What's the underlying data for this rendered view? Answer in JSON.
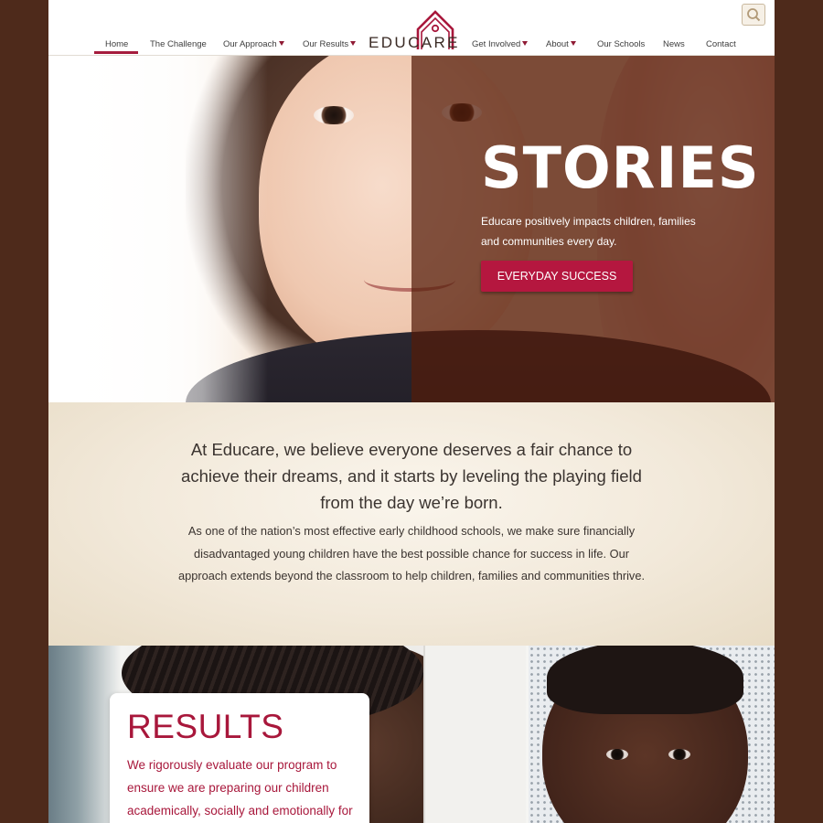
{
  "nav": {
    "items": [
      {
        "label": "Home"
      },
      {
        "label": "The Challenge"
      },
      {
        "label": "Our Approach"
      },
      {
        "label": "Our Results"
      },
      {
        "label": "Get Involved"
      },
      {
        "label": "About"
      },
      {
        "label": "Our Schools"
      },
      {
        "label": "News"
      },
      {
        "label": "Contact"
      }
    ],
    "active": "Home",
    "icons": {
      "dropdown": "caret-down-icon",
      "search": "search-icon"
    }
  },
  "logo": {
    "text": "EDUCARE",
    "icon": "schoolhouse-icon",
    "color": "#a8173b"
  },
  "hero": {
    "title": "STORIES",
    "subtitle": "Educare positively impacts children, families and communities every day.",
    "button_label": "EVERYDAY SUCCESS"
  },
  "intro": {
    "lead": "At Educare, we believe everyone deserves a fair chance to achieve their dreams, and it starts by leveling the playing field from the day we’re born.",
    "body": "As one of the nation’s most effective early childhood schools, we make sure financially disadvantaged young children have the best possible chance for success in life. Our approach extends beyond the classroom to help children, families and communities thrive."
  },
  "results": {
    "title": "RESULTS",
    "text": "We rigorously evaluate our program to ensure we are preparing our children academically, socially and emotionally for"
  },
  "colors": {
    "brand": "#a8173b",
    "button": "#b5173f",
    "frame": "#4e2a1b",
    "cream": "#f2e9da"
  }
}
